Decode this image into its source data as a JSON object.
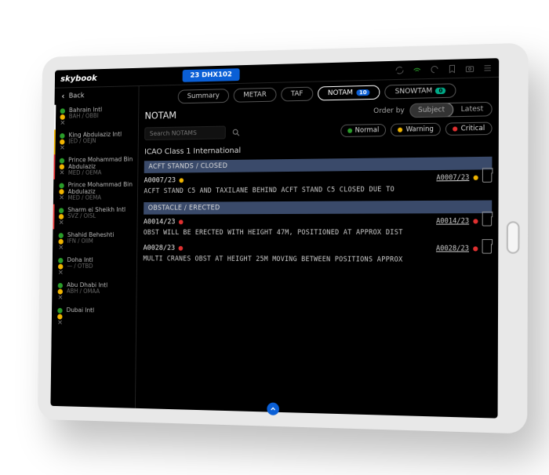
{
  "brand": "skybook",
  "flight": "23 DHX102",
  "back": "Back",
  "sidebar": {
    "airports": [
      {
        "name": "Bahrain Intl",
        "code": "BAH / OBBI",
        "state": "active"
      },
      {
        "name": "King Abdulaziz Intl",
        "code": "JED / OEJN",
        "state": "w"
      },
      {
        "name": "Prince Mohammad Bin Abdulaziz",
        "code": "MED / OEMA",
        "state": "c"
      },
      {
        "name": "Prince Mohammad Bin Abdulaziz",
        "code": "MED / OEMA",
        "state": ""
      },
      {
        "name": "Sharm el Sheikh Intl",
        "code": "SVZ / OISL",
        "state": "c"
      },
      {
        "name": "Shahid Beheshti",
        "code": "IFN / OIIM",
        "state": ""
      },
      {
        "name": "Doha Intl",
        "code": "— / OTBD",
        "state": ""
      },
      {
        "name": "Abu Dhabi Intl",
        "code": "ABH / OMAA",
        "state": ""
      },
      {
        "name": "Dubai Intl",
        "code": "",
        "state": ""
      }
    ]
  },
  "tabs": [
    {
      "label": "Summary",
      "badge": ""
    },
    {
      "label": "METAR",
      "badge": ""
    },
    {
      "label": "TAF",
      "badge": ""
    },
    {
      "label": "NOTAM",
      "badge": "10",
      "active": true
    },
    {
      "label": "SNOWTAM",
      "badge": "0"
    }
  ],
  "page_title": "NOTAM",
  "order_label": "Order by",
  "order_options": {
    "a": "Subject",
    "b": "Latest"
  },
  "search_placeholder": "Search NOTAMS",
  "filters": {
    "normal": "Normal",
    "warning": "Warning",
    "critical": "Critical"
  },
  "colors": {
    "normal": "#2a9d2a",
    "warning": "#f0b400",
    "critical": "#e03030",
    "accent": "#0a5fd6"
  },
  "section": "ICAO Class 1 International",
  "groups": [
    {
      "cat": "ACFT STANDS / CLOSED",
      "items": [
        {
          "id": "A0007/23",
          "sev": "warning",
          "text": "ACFT STAND C5 AND TAXILANE BEHIND ACFT STAND C5 CLOSED DUE TO",
          "ref": "A0007/23"
        }
      ]
    },
    {
      "cat": "OBSTACLE / ERECTED",
      "items": [
        {
          "id": "A0014/23",
          "sev": "critical",
          "text": "OBST WILL BE ERECTED WITH HEIGHT 47M, POSITIONED AT APPROX DIST",
          "ref": "A0014/23"
        },
        {
          "id": "A0028/23",
          "sev": "critical",
          "text": "MULTI CRANES OBST AT HEIGHT 25M MOVING BETWEEN POSITIONS APPROX",
          "ref": "A0028/23"
        }
      ]
    }
  ]
}
